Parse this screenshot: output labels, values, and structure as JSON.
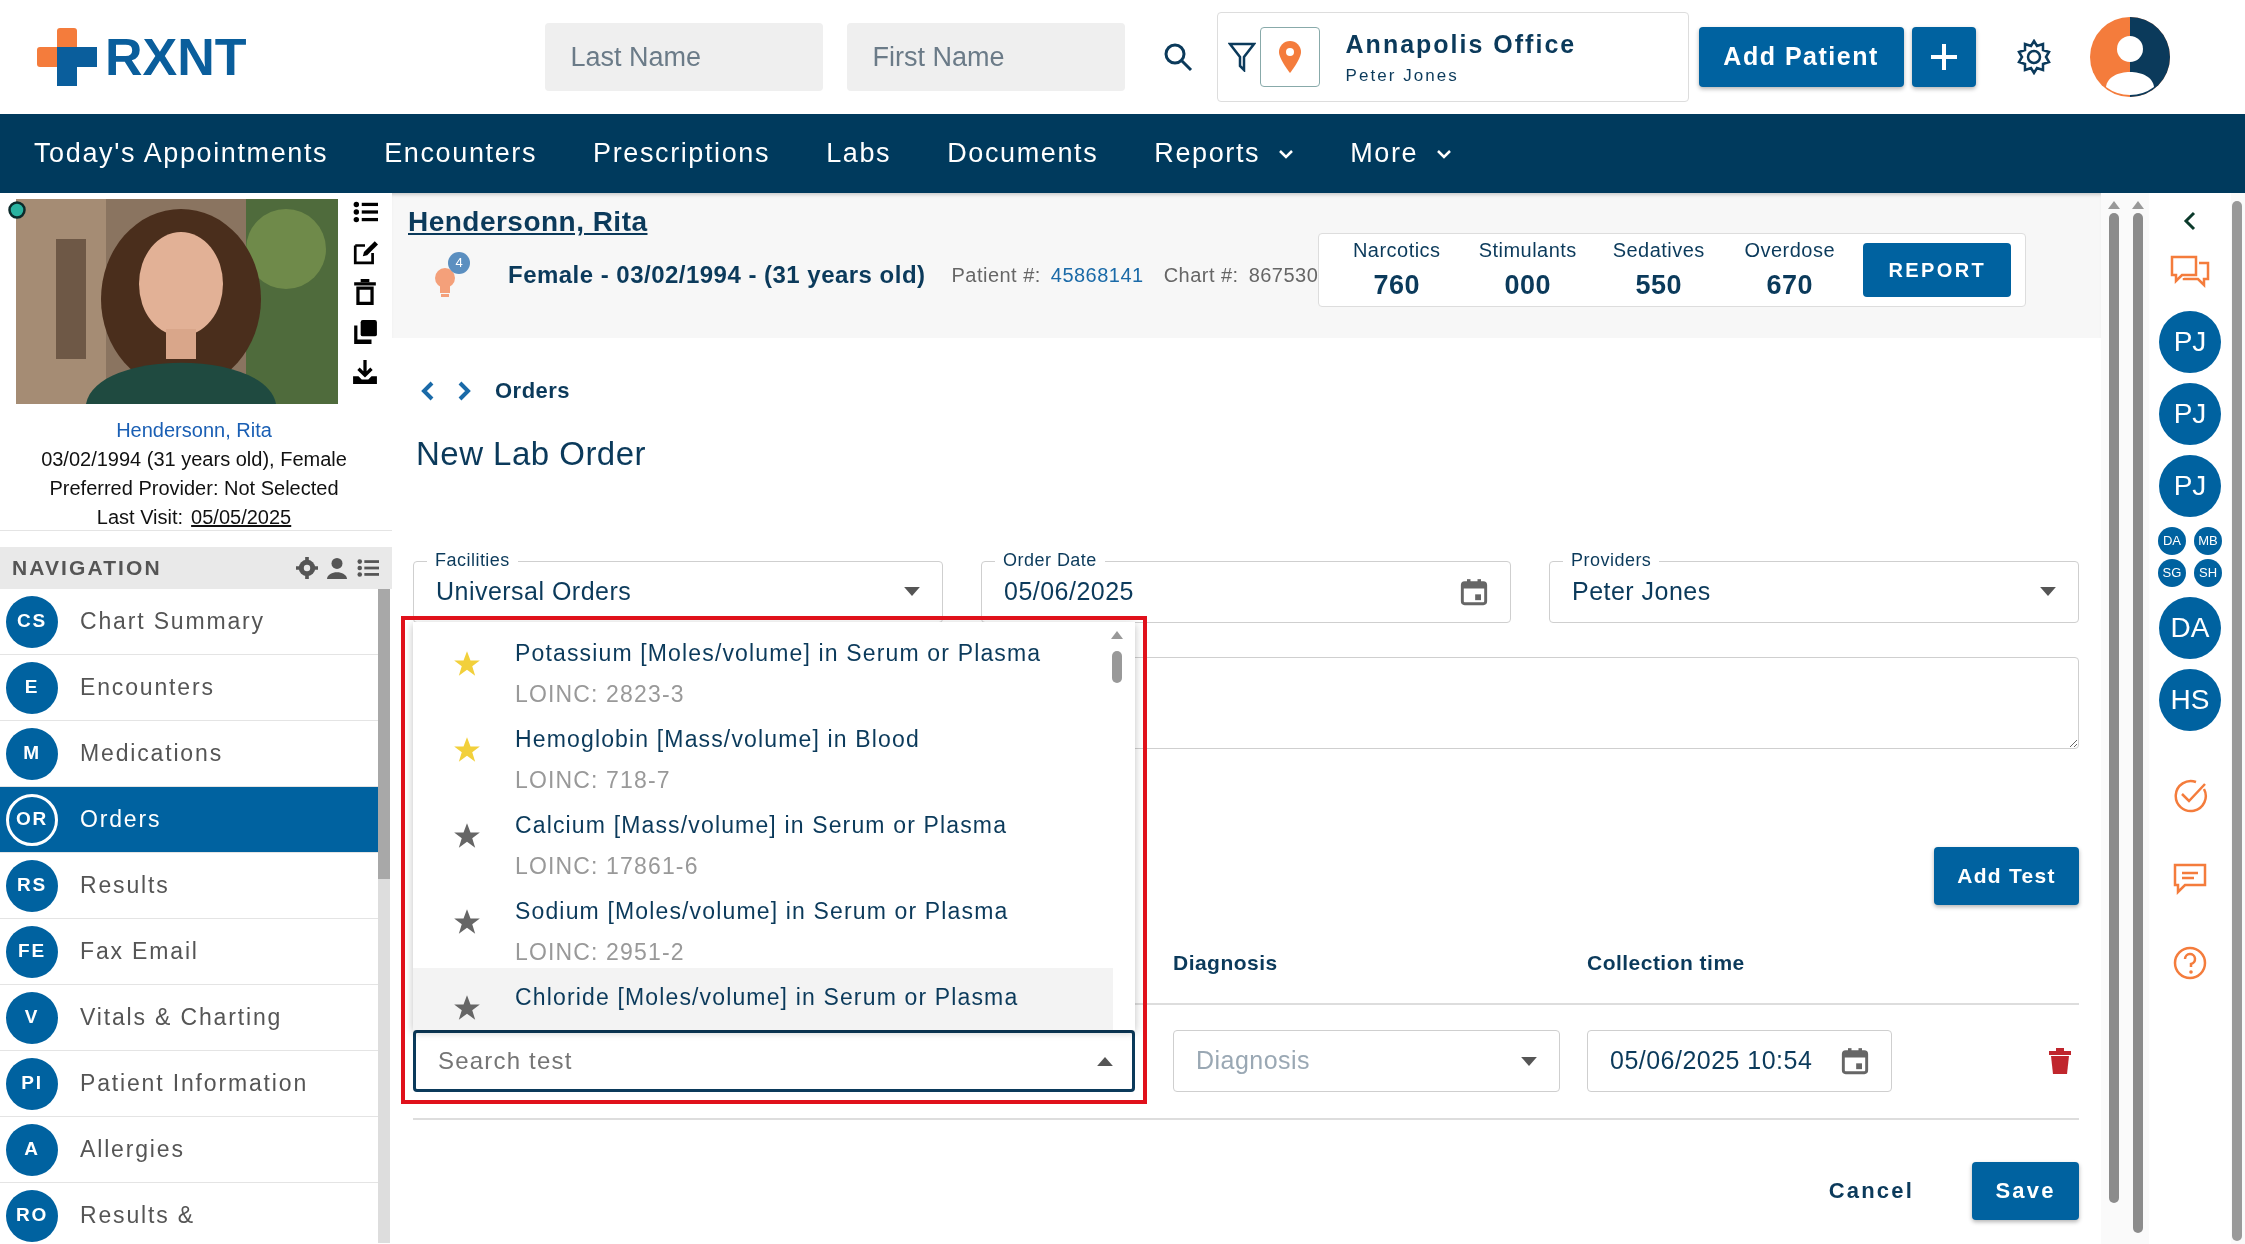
{
  "header": {
    "logo": "RXNT",
    "search": [
      {
        "placeholder": "Last Name"
      },
      {
        "placeholder": "First Name"
      }
    ],
    "office": {
      "name": "Annapolis Office",
      "user": "Peter Jones"
    },
    "add_patient": "Add Patient"
  },
  "menu": [
    {
      "label": "Today's Appointments",
      "has_dropdown": false
    },
    {
      "label": "Encounters",
      "has_dropdown": false
    },
    {
      "label": "Prescriptions",
      "has_dropdown": false
    },
    {
      "label": "Labs",
      "has_dropdown": false
    },
    {
      "label": "Documents",
      "has_dropdown": false
    },
    {
      "label": "Reports",
      "has_dropdown": true
    },
    {
      "label": "More",
      "has_dropdown": true
    }
  ],
  "patient_card": {
    "name": "Hendersonn, Rita",
    "details": "03/02/1994 (31 years old), Female",
    "preferred_provider": "Preferred Provider: Not Selected",
    "last_visit_label": "Last Visit:",
    "last_visit": "05/05/2025"
  },
  "navigation": {
    "title": "NAVIGATION",
    "items": [
      {
        "initials": "CS",
        "label": "Chart Summary",
        "selected": false
      },
      {
        "initials": "E",
        "label": "Encounters",
        "selected": false
      },
      {
        "initials": "M",
        "label": "Medications",
        "selected": false
      },
      {
        "initials": "OR",
        "label": "Orders",
        "selected": true
      },
      {
        "initials": "RS",
        "label": "Results",
        "selected": false
      },
      {
        "initials": "FE",
        "label": "Fax Email",
        "selected": false
      },
      {
        "initials": "V",
        "label": "Vitals & Charting",
        "selected": false
      },
      {
        "initials": "PI",
        "label": "Patient Information",
        "selected": false
      },
      {
        "initials": "A",
        "label": "Allergies",
        "selected": false
      },
      {
        "initials": "RO",
        "label": "Results &",
        "selected": false
      }
    ]
  },
  "patient_header": {
    "name": "Hendersonn, Rita",
    "alerts_count": "4",
    "summary": "Female - 03/02/1994 - (31 years old)",
    "patient_no_label": "Patient #:",
    "patient_no": "45868141",
    "chart_label": "Chart #:",
    "chart_no": "867530",
    "scores": [
      {
        "label": "Narcotics",
        "value": "760"
      },
      {
        "label": "Stimulants",
        "value": "000"
      },
      {
        "label": "Sedatives",
        "value": "550"
      },
      {
        "label": "Overdose",
        "value": "670"
      }
    ],
    "report_button": "REPORT"
  },
  "breadcrumb": "Orders",
  "title": "New Lab Order",
  "form": {
    "facilities": {
      "label": "Facilities",
      "value": "Universal Orders"
    },
    "order_date": {
      "label": "Order Date",
      "value": "05/06/2025"
    },
    "providers": {
      "label": "Providers",
      "value": "Peter Jones"
    }
  },
  "add_test_button": "Add Test",
  "tests_table": {
    "columns": [
      "Diagnosis",
      "Collection time"
    ],
    "rows": [
      {
        "test_placeholder": "Search test",
        "diagnosis_placeholder": "Diagnosis",
        "collection_time": "05/06/2025 10:54"
      }
    ]
  },
  "test_dropdown": {
    "options": [
      {
        "name": "Potassium [Moles/volume] in Serum or Plasma",
        "code": "LOINC: 2823-3",
        "favorite": true,
        "highlighted": false
      },
      {
        "name": "Hemoglobin [Mass/volume] in Blood",
        "code": "LOINC: 718-7",
        "favorite": true,
        "highlighted": false
      },
      {
        "name": "Calcium [Mass/volume] in Serum or Plasma",
        "code": "LOINC: 17861-6",
        "favorite": false,
        "highlighted": false
      },
      {
        "name": "Sodium [Moles/volume] in Serum or Plasma",
        "code": "LOINC: 2951-2",
        "favorite": false,
        "highlighted": false
      },
      {
        "name": "Chloride [Moles/volume] in Serum or Plasma",
        "favorite": false,
        "highlighted": true
      }
    ]
  },
  "footer_buttons": {
    "cancel": "Cancel",
    "save": "Save"
  },
  "right_rail": {
    "avatars": [
      {
        "initials": "PJ",
        "kind": "large"
      },
      {
        "initials": "PJ",
        "kind": "large"
      },
      {
        "initials": "PJ",
        "kind": "large"
      },
      {
        "initials": "DA",
        "kind": "small"
      },
      {
        "initials": "MB",
        "kind": "small"
      },
      {
        "initials": "SG",
        "kind": "small"
      },
      {
        "initials": "SH",
        "kind": "small"
      },
      {
        "initials": "DA",
        "kind": "large"
      },
      {
        "initials": "HS",
        "kind": "large"
      }
    ]
  }
}
